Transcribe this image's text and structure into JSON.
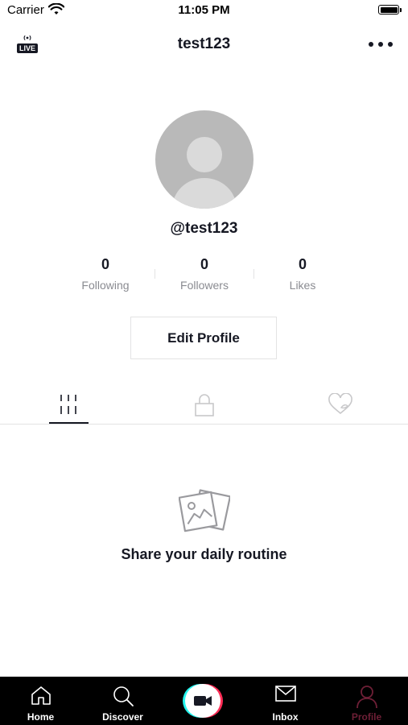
{
  "status_bar": {
    "carrier": "Carrier",
    "time": "11:05 PM"
  },
  "header": {
    "live_label": "LIVE",
    "title": "test123"
  },
  "profile": {
    "handle": "@test123",
    "stats": [
      {
        "value": "0",
        "label": "Following"
      },
      {
        "value": "0",
        "label": "Followers"
      },
      {
        "value": "0",
        "label": "Likes"
      }
    ],
    "edit_button": "Edit Profile"
  },
  "content_tabs": {
    "selected": "videos",
    "items": [
      "videos-grid-icon",
      "lock-icon",
      "liked-heart-icon"
    ]
  },
  "empty_state": {
    "message": "Share your daily routine"
  },
  "bottom_nav": {
    "active": "Profile",
    "active_color": "#6e1f36",
    "items": [
      {
        "label": "Home",
        "icon": "home-icon"
      },
      {
        "label": "Discover",
        "icon": "search-icon"
      },
      {
        "label": "",
        "icon": "video-camera-icon"
      },
      {
        "label": "Inbox",
        "icon": "mail-icon"
      },
      {
        "label": "Profile",
        "icon": "person-icon"
      }
    ]
  }
}
